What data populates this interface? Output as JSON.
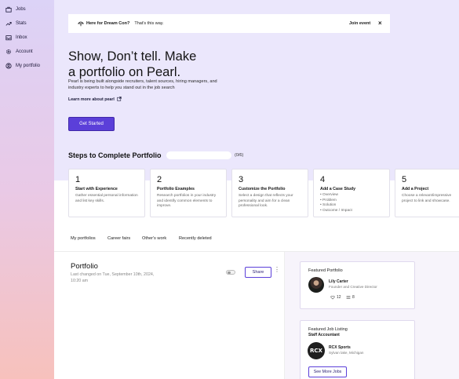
{
  "sidebar": {
    "items": [
      {
        "label": "Jobs",
        "icon": "briefcase-icon"
      },
      {
        "label": "Stats",
        "icon": "trend-icon"
      },
      {
        "label": "Inbox",
        "icon": "inbox-icon"
      },
      {
        "label": "Account",
        "icon": "gear-icon"
      },
      {
        "label": "My portfolio",
        "icon": "user-icon"
      }
    ]
  },
  "banner": {
    "icon": "umbrella-icon",
    "title": "Here for Dream Con?",
    "text": "That's this way.",
    "join_label": "Join event",
    "close_glyph": "×"
  },
  "hero": {
    "headline_line1": "Show, Don’t tell. Make",
    "headline_line2": "a portfolio on Pearl.",
    "subtext": "Pearl is being built alongside recruiters, talent sources, hiring managers, and industry experts to help you stand out in the job search",
    "learn_more": "Learn more about pearl",
    "get_started": "Get Started"
  },
  "steps": {
    "title": "Steps to Complete Portfolio",
    "progress_text": "(0/6)",
    "progress_fraction": 0,
    "cards": [
      {
        "num": "1",
        "title": "Start with Experience",
        "desc": "Gather essential personal information and list key skills."
      },
      {
        "num": "2",
        "title": "Portfolio Examples",
        "desc": "Research portfolios in your industry and identify common elements to improve."
      },
      {
        "num": "3",
        "title": "Customize the Portfolio",
        "desc": "Select a design that reflects your personality and aim for a clean professional look."
      },
      {
        "num": "4",
        "title": "Add a Case Study",
        "bullets": [
          "Overview",
          "Problem",
          "Solution",
          "Outcome / Impact"
        ]
      },
      {
        "num": "5",
        "title": "Add a Project",
        "desc": "Choose a relevant/impressive project to link and showcase."
      }
    ]
  },
  "tabs": [
    "My portfolios",
    "Career fairs",
    "Other's work",
    "Recently deleted"
  ],
  "portfolio": {
    "title": "Portfolio",
    "meta": "Last changed on Tue, September 10th, 2024, 10:20 am",
    "share_label": "Share",
    "more_glyph": "⋮"
  },
  "featured": {
    "title": "Featured Portfolio",
    "name": "Lily Carter",
    "role": "Founder and Creative Director",
    "likes": "12",
    "count": "8"
  },
  "job": {
    "title": "Featured Job Listing",
    "position": "Staff Accountant",
    "logo_text": "RCX",
    "company": "RCX Sports",
    "location": "Sylvan lake, Michigan",
    "see_more": "See More Jobs"
  },
  "colors": {
    "accent": "#5b3fd9",
    "hero_bg": "#ebe7fc"
  }
}
